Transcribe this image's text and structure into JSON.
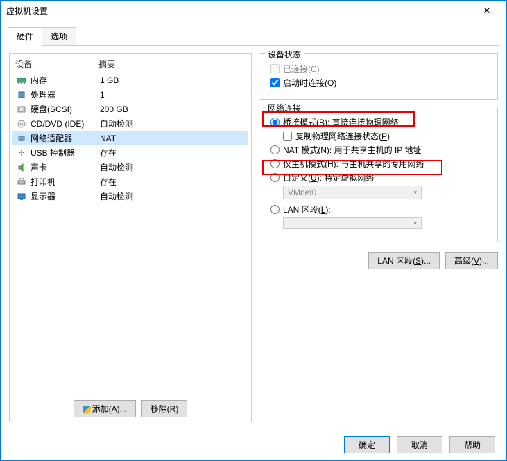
{
  "window": {
    "title": "虚拟机设置",
    "close": "✕"
  },
  "tabs": {
    "hardware": "硬件",
    "options": "选项"
  },
  "hwlist": {
    "col_device": "设备",
    "col_summary": "摘要",
    "items": [
      {
        "name": "内存",
        "summary": "1 GB",
        "icon": "memory"
      },
      {
        "name": "处理器",
        "summary": "1",
        "icon": "cpu"
      },
      {
        "name": "硬盘(SCSI)",
        "summary": "200 GB",
        "icon": "hdd"
      },
      {
        "name": "CD/DVD (IDE)",
        "summary": "自动检测",
        "icon": "cd"
      },
      {
        "name": "网络适配器",
        "summary": "NAT",
        "icon": "net"
      },
      {
        "name": "USB 控制器",
        "summary": "存在",
        "icon": "usb"
      },
      {
        "name": "声卡",
        "summary": "自动检测",
        "icon": "sound"
      },
      {
        "name": "打印机",
        "summary": "存在",
        "icon": "printer"
      },
      {
        "name": "显示器",
        "summary": "自动检测",
        "icon": "display"
      }
    ]
  },
  "leftbtn": {
    "add": "添加(A)...",
    "remove": "移除(R)"
  },
  "status": {
    "title": "设备状态",
    "connected": "已连接(C)",
    "connect_on_start": "启动时连接(O)"
  },
  "net": {
    "title": "网络连接",
    "bridged": "桥接模式(B): 直接连接物理网络",
    "replicate": "复制物理网络连接状态(P)",
    "nat": "NAT 模式(N): 用于共享主机的 IP 地址",
    "hostonly": "仅主机模式(H): 与主机共享的专用网络",
    "custom": "自定义(U): 特定虚拟网络",
    "vmnet": "VMnet0",
    "lanseg": "LAN 区段(L):",
    "lanseg_btn": "LAN 区段(S)...",
    "advanced_btn": "高级(V)..."
  },
  "footer": {
    "ok": "确定",
    "cancel": "取消",
    "help": "帮助"
  }
}
